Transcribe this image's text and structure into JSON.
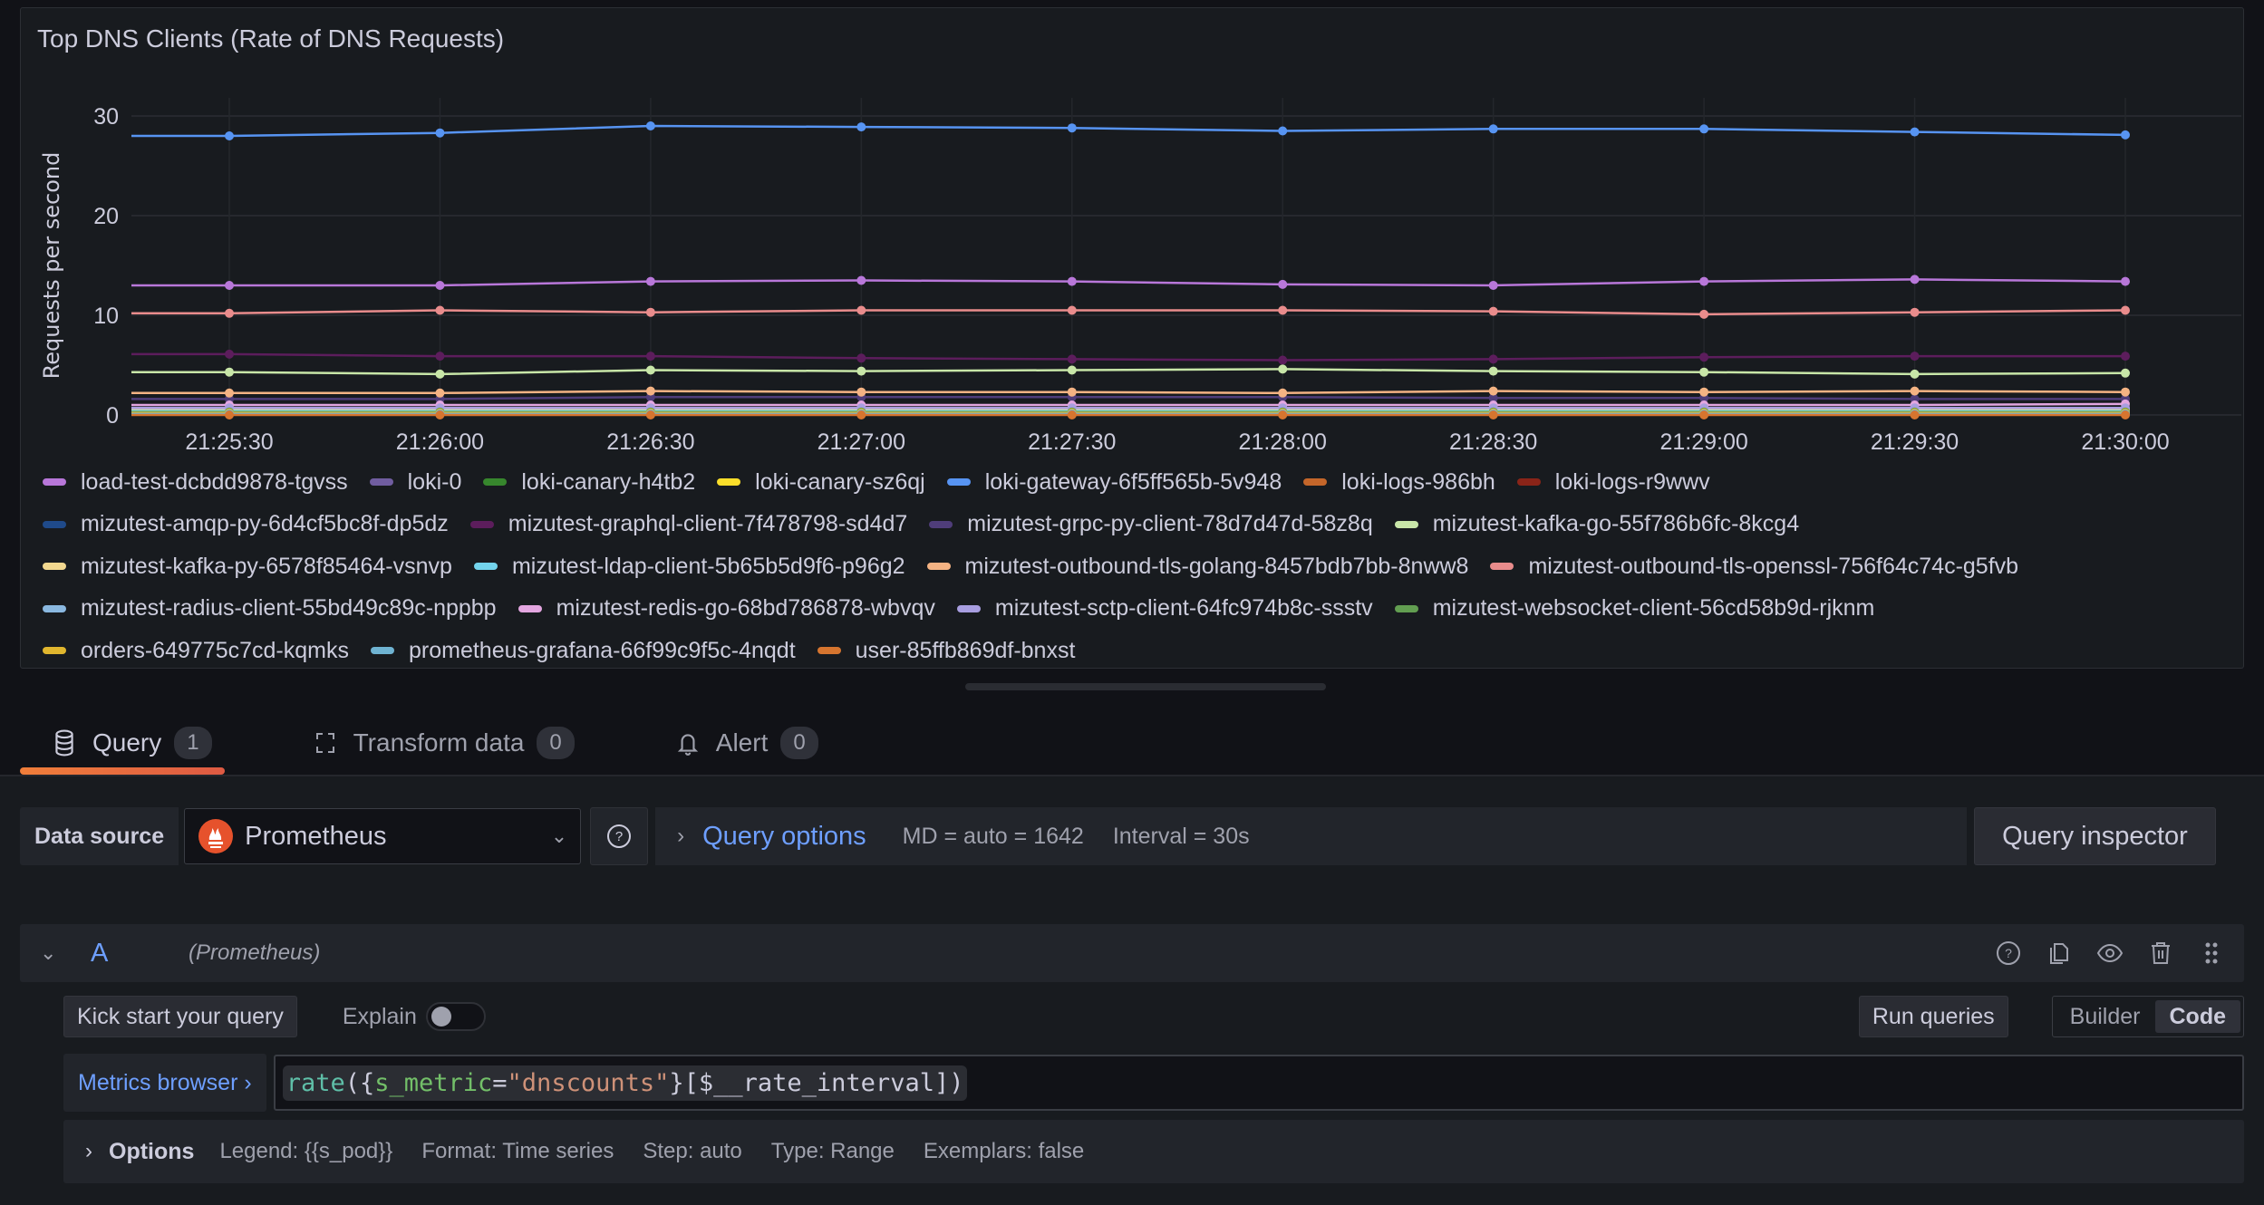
{
  "panel": {
    "title": "Top DNS Clients (Rate of DNS Requests)"
  },
  "chart_data": {
    "type": "line",
    "title": "Top DNS Clients (Rate of DNS Requests)",
    "xlabel": "",
    "ylabel": "Requests per second",
    "ylim": [
      0,
      30
    ],
    "yticks": [
      "0",
      "10",
      "20",
      "30"
    ],
    "ytick_values": [
      0,
      10,
      20,
      30
    ],
    "grid": true,
    "legend_position": "bottom",
    "x": [
      "21:25:30",
      "21:26:00",
      "21:26:30",
      "21:27:00",
      "21:27:30",
      "21:28:00",
      "21:28:30",
      "21:29:00",
      "21:29:30",
      "21:30:00"
    ],
    "series": [
      {
        "name": "load-test-dcbdd9878-tgvss",
        "color": "#b877d9",
        "values": [
          13.0,
          13.0,
          13.4,
          13.5,
          13.4,
          13.1,
          13.0,
          13.4,
          13.6,
          13.4
        ]
      },
      {
        "name": "loki-0",
        "color": "#705da0",
        "values": [
          0.4,
          0.4,
          0.4,
          0.4,
          0.4,
          0.4,
          0.4,
          0.4,
          0.4,
          0.4
        ]
      },
      {
        "name": "loki-canary-h4tb2",
        "color": "#37872d",
        "values": [
          0.2,
          0.2,
          0.2,
          0.2,
          0.2,
          0.2,
          0.2,
          0.2,
          0.2,
          0.2
        ]
      },
      {
        "name": "loki-canary-sz6qj",
        "color": "#fade2a",
        "values": [
          0.5,
          0.5,
          0.5,
          0.5,
          0.5,
          0.5,
          0.5,
          0.5,
          0.5,
          0.5
        ]
      },
      {
        "name": "loki-gateway-6f5ff565b-5v948",
        "color": "#5794f2",
        "values": [
          28.0,
          28.3,
          29.0,
          28.9,
          28.8,
          28.5,
          28.7,
          28.7,
          28.4,
          28.1
        ]
      },
      {
        "name": "loki-logs-986bh",
        "color": "#c4662a",
        "values": [
          0.1,
          0.1,
          0.1,
          0.1,
          0.1,
          0.1,
          0.1,
          0.1,
          0.1,
          0.1
        ]
      },
      {
        "name": "loki-logs-r9wwv",
        "color": "#8a2418",
        "values": [
          0.3,
          0.3,
          0.3,
          0.3,
          0.3,
          0.3,
          0.3,
          0.3,
          0.3,
          0.3
        ]
      },
      {
        "name": "mizutest-amqp-py-6d4cf5bc8f-dp5dz",
        "color": "#1f4a8a",
        "values": [
          0.3,
          0.3,
          0.3,
          0.3,
          0.3,
          0.3,
          0.3,
          0.3,
          0.3,
          0.3
        ]
      },
      {
        "name": "mizutest-graphql-client-7f478798-sd4d7",
        "color": "#5c1d5c",
        "values": [
          6.1,
          5.9,
          5.9,
          5.7,
          5.6,
          5.5,
          5.6,
          5.8,
          5.9,
          5.9
        ]
      },
      {
        "name": "mizutest-grpc-py-client-78d7d47d-58z8q",
        "color": "#4f3d7a",
        "values": [
          1.6,
          1.6,
          1.8,
          1.8,
          1.8,
          1.8,
          1.7,
          1.7,
          1.6,
          1.6
        ]
      },
      {
        "name": "mizutest-kafka-go-55f786b6fc-8kcg4",
        "color": "#c8e6a8",
        "values": [
          4.3,
          4.1,
          4.5,
          4.4,
          4.5,
          4.6,
          4.4,
          4.3,
          4.1,
          4.2
        ]
      },
      {
        "name": "mizutest-kafka-py-6578f85464-vsnvp",
        "color": "#f2d88f",
        "values": [
          0.6,
          0.6,
          0.6,
          0.6,
          0.6,
          0.6,
          0.6,
          0.6,
          0.6,
          0.6
        ]
      },
      {
        "name": "mizutest-ldap-client-5b65b5d9f6-p96g2",
        "color": "#73d4ec",
        "values": [
          0.4,
          0.4,
          0.4,
          0.4,
          0.4,
          0.4,
          0.4,
          0.4,
          0.4,
          0.4
        ]
      },
      {
        "name": "mizutest-outbound-tls-golang-8457bdb7bb-8nww8",
        "color": "#f4b383",
        "values": [
          2.2,
          2.2,
          2.4,
          2.3,
          2.3,
          2.2,
          2.4,
          2.3,
          2.4,
          2.3
        ]
      },
      {
        "name": "mizutest-outbound-tls-openssl-756f64c74c-g5fvb",
        "color": "#e98c8c",
        "values": [
          10.2,
          10.5,
          10.3,
          10.5,
          10.5,
          10.5,
          10.4,
          10.1,
          10.3,
          10.5
        ]
      },
      {
        "name": "mizutest-radius-client-55bd49c89c-nppbp",
        "color": "#8ab8e0",
        "values": [
          0.2,
          0.2,
          0.2,
          0.2,
          0.2,
          0.2,
          0.2,
          0.2,
          0.2,
          0.2
        ]
      },
      {
        "name": "mizutest-redis-go-68bd786878-wbvqv",
        "color": "#e3a6e0",
        "values": [
          1.0,
          1.0,
          1.0,
          1.0,
          1.0,
          1.0,
          1.0,
          1.0,
          1.0,
          1.1
        ]
      },
      {
        "name": "mizutest-sctp-client-64fc974b8c-ssstv",
        "color": "#a89ee0",
        "values": [
          0.7,
          0.7,
          0.7,
          0.7,
          0.7,
          0.7,
          0.7,
          0.7,
          0.7,
          0.7
        ]
      },
      {
        "name": "mizutest-websocket-client-56cd58b9d-rjknm",
        "color": "#629e51",
        "values": [
          0.3,
          0.3,
          0.3,
          0.3,
          0.3,
          0.3,
          0.3,
          0.3,
          0.3,
          0.3
        ]
      },
      {
        "name": "orders-649775c7cd-kqmks",
        "color": "#e0b62e",
        "values": [
          0.2,
          0.2,
          0.2,
          0.2,
          0.2,
          0.2,
          0.2,
          0.2,
          0.2,
          0.2
        ]
      },
      {
        "name": "prometheus-grafana-66f99c9f5c-4nqdt",
        "color": "#6fb3d2",
        "values": [
          0.1,
          0.1,
          0.1,
          0.1,
          0.1,
          0.1,
          0.1,
          0.1,
          0.1,
          0.1
        ]
      },
      {
        "name": "user-85ffb869df-bnxst",
        "color": "#d6752f",
        "values": [
          0.0,
          0.0,
          0.0,
          0.0,
          0.0,
          0.0,
          0.0,
          0.0,
          0.0,
          0.0
        ]
      }
    ]
  },
  "legend_rows": [
    [
      0,
      1,
      2,
      3,
      4,
      5,
      6
    ],
    [
      7,
      8,
      9,
      10
    ],
    [
      11,
      12,
      13,
      14
    ],
    [
      15,
      16,
      17,
      18
    ],
    [
      19,
      20,
      21
    ]
  ],
  "tabs": [
    {
      "label": "Query",
      "count": "1",
      "icon": "database-icon",
      "active": true
    },
    {
      "label": "Transform data",
      "count": "0",
      "icon": "transform-icon",
      "active": false
    },
    {
      "label": "Alert",
      "count": "0",
      "icon": "bell-icon",
      "active": false
    }
  ],
  "datasource": {
    "label": "Data source",
    "selected": "Prometheus",
    "query_options_label": "Query options",
    "md": "MD = auto = 1642",
    "interval": "Interval = 30s",
    "query_inspector_label": "Query inspector"
  },
  "query": {
    "ref_id": "A",
    "datasource_name": "(Prometheus)",
    "kick_start_label": "Kick start your query",
    "explain_label": "Explain",
    "explain_enabled": false,
    "run_queries_label": "Run queries",
    "modes": [
      "Builder",
      "Code"
    ],
    "active_mode": "Code",
    "metrics_browser_label": "Metrics browser ›",
    "expr_parts": {
      "fn": "rate",
      "open": "({",
      "label": "s_metric",
      "eq": "=",
      "value": "\"dnscounts\"",
      "rest": "}[$__rate_interval])"
    },
    "options": {
      "title": "Options",
      "legend": "Legend: {{s_pod}}",
      "format": "Format: Time series",
      "step": "Step: auto",
      "type": "Type: Range",
      "exemplars": "Exemplars: false"
    }
  }
}
